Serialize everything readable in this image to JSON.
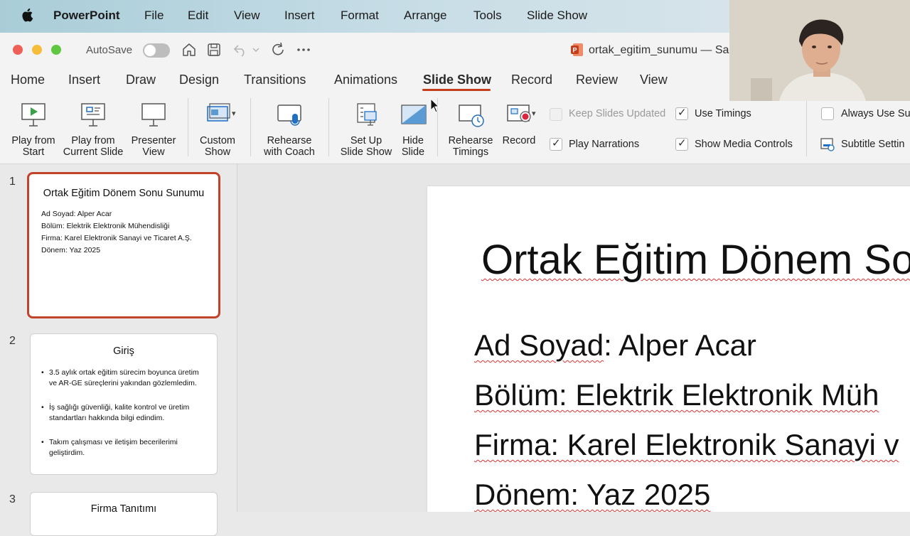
{
  "menubar": {
    "app": "PowerPoint",
    "items": [
      "File",
      "Edit",
      "View",
      "Insert",
      "Format",
      "Arrange",
      "Tools",
      "Slide Show"
    ]
  },
  "titlebar": {
    "autosave": "AutoSave",
    "filename": "ortak_egitim_sunumu — Sa"
  },
  "tabs": {
    "items": [
      "Home",
      "Insert",
      "Draw",
      "Design",
      "Transitions",
      "Animations",
      "Slide Show",
      "Record",
      "Review",
      "View"
    ],
    "active": "Slide Show"
  },
  "ribbon": {
    "play_from_start": [
      "Play from",
      "Start"
    ],
    "play_from_current": [
      "Play from",
      "Current Slide"
    ],
    "presenter_view": [
      "Presenter",
      "View"
    ],
    "custom_show": [
      "Custom",
      "Show"
    ],
    "rehearse_coach": [
      "Rehearse",
      "with Coach"
    ],
    "set_up": [
      "Set Up",
      "Slide Show"
    ],
    "hide_slide": [
      "Hide",
      "Slide"
    ],
    "rehearse_timings": [
      "Rehearse",
      "Timings"
    ],
    "record": "Record",
    "keep_slides_updated": "Keep Slides Updated",
    "play_narrations": "Play Narrations",
    "use_timings": "Use Timings",
    "show_media_controls": "Show Media Controls",
    "always_use_subtitles": "Always Use Sub",
    "subtitle_settings": "Subtitle Settin"
  },
  "thumbnails": [
    {
      "number": "1",
      "title": "Ortak Eğitim Dönem Sonu Sunumu",
      "lines": [
        "Ad Soyad: Alper Acar",
        "Bölüm: Elektrik Elektronik Mühendisliği",
        "Firma: Karel Elektronik Sanayi ve Ticaret A.Ş.",
        "Dönem: Yaz 2025"
      ]
    },
    {
      "number": "2",
      "title": "Giriş",
      "bullets": [
        [
          "3.5 aylık ortak eğitim sürecim boyunca üretim",
          "ve AR-GE süreçlerini yakından gözlemledim."
        ],
        [
          "İş sağlığı güvenliği, kalite kontrol ve üretim",
          "standartları hakkında bilgi edindim."
        ],
        [
          "Takım çalışması ve iletişim becerilerimi",
          "geliştirdim."
        ]
      ]
    },
    {
      "number": "3",
      "title": "Firma Tanıtımı"
    }
  ],
  "slide": {
    "title": "Ortak Eğitim Dönem So",
    "lines": {
      "name_label": "Ad Soyad",
      "name_value": ": Alper Acar",
      "dept": "Bölüm: Elektrik Elektronik Müh",
      "firm": "Firma: Karel Elektronik Sanayi v",
      "term": "Dönem: Yaz 2025"
    }
  }
}
